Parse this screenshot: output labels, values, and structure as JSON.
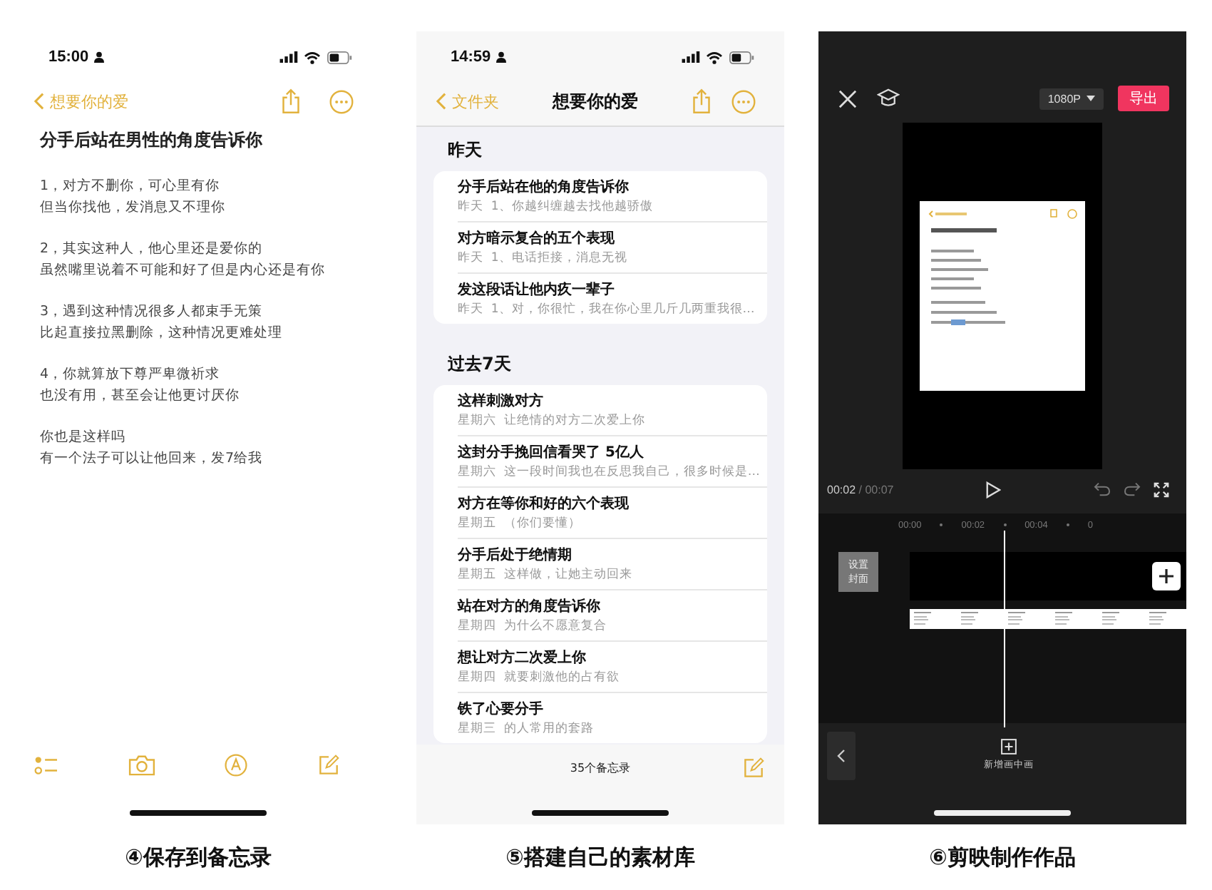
{
  "phones": [
    {
      "kind": "note",
      "time": "15:00",
      "back": "想要你的爱",
      "title": "分手后站在男性的角度告诉你",
      "paragraphs": [
        [
          "1，对方不删你，可心里有你",
          "但当你找他，发消息又不理你"
        ],
        [
          "2，其实这种人，他心里还是爱你的",
          "虽然嘴里说着不可能和好了但是内心还是有你"
        ],
        [
          "3，遇到这种情况很多人都束手无策",
          "比起直接拉黑删除，这种情况更难处理"
        ],
        [
          "4，你就算放下尊严卑微祈求",
          "也没有用，甚至会让他更讨厌你"
        ],
        [
          "你也是这样吗",
          "有一个法子可以让他回来，发7给我"
        ]
      ],
      "caption": "④保存到备忘录"
    },
    {
      "kind": "list",
      "time": "14:59",
      "back": "文件夹",
      "title": "想要你的爱",
      "sections": [
        {
          "heading": "昨天",
          "notes": [
            {
              "title": "分手后站在他的角度告诉你",
              "date": "昨天",
              "preview": "1、你越纠缠越去找他越骄傲"
            },
            {
              "title": "对方暗示复合的五个表现",
              "date": "昨天",
              "preview": "1、电话拒接，消息无视"
            },
            {
              "title": "发这段话让他内疚一辈子",
              "date": "昨天",
              "preview": "1、对，你很忙，我在你心里几斤几两重我很…"
            }
          ]
        },
        {
          "heading": "过去7天",
          "notes": [
            {
              "title": "这样刺激对方",
              "date": "星期六",
              "preview": "让绝情的对方二次爱上你"
            },
            {
              "title": "这封分手挽回信看哭了 5亿人",
              "date": "星期六",
              "preview": "这一段时间我也在反思我自己，很多时候是…"
            },
            {
              "title": "对方在等你和好的六个表现",
              "date": "星期五",
              "preview": "（你们要懂）"
            },
            {
              "title": "分手后处于绝情期",
              "date": "星期五",
              "preview": "这样做，让她主动回来"
            },
            {
              "title": "站在对方的角度告诉你",
              "date": "星期四",
              "preview": "为什么不愿意复合"
            },
            {
              "title": "想让对方二次爱上你",
              "date": "星期四",
              "preview": "就要刺激他的占有欲"
            },
            {
              "title": "铁了心要分手",
              "date": "星期三",
              "preview": "的人常用的套路"
            }
          ]
        }
      ],
      "count": "35个备忘录",
      "caption": "⑤搭建自己的素材库"
    },
    {
      "kind": "editor",
      "resolution": "1080P",
      "export": "导出",
      "current": "00:02",
      "total": "/ 00:07",
      "ticks": [
        "00:00",
        "00:02",
        "00:04",
        "0"
      ],
      "cover": "设置封面",
      "add_label": "新增画中画",
      "caption": "⑥剪映制作作品"
    }
  ]
}
